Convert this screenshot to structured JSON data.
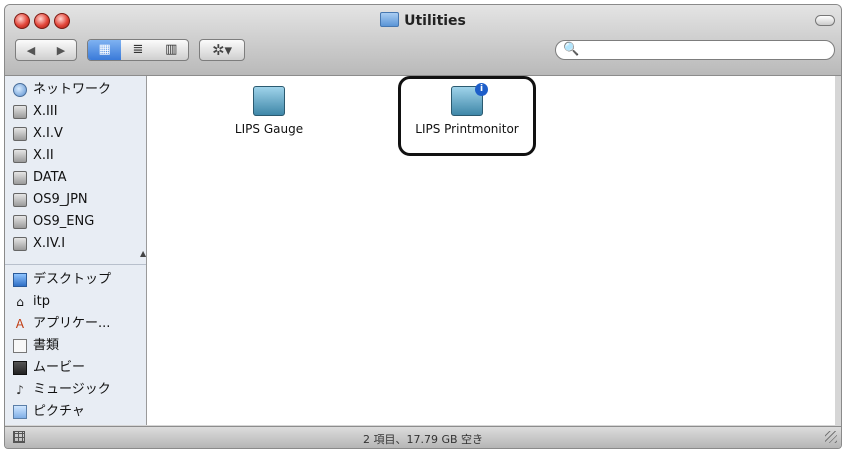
{
  "window": {
    "title": "Utilities"
  },
  "toolbar": {
    "back_glyph": "◀",
    "forward_glyph": "▶",
    "view_icon": "▦",
    "view_list": "≣",
    "view_column": "▥",
    "action_glyph": "✲▾",
    "search_placeholder": "",
    "search_glyph": "🔍"
  },
  "sidebar": {
    "items": [
      {
        "label": "ネットワーク",
        "icon": "globe-icon"
      },
      {
        "label": "X.III",
        "icon": "disk-icon"
      },
      {
        "label": "X.I.V",
        "icon": "disk-icon"
      },
      {
        "label": "X.II",
        "icon": "disk-icon"
      },
      {
        "label": "DATA",
        "icon": "disk-icon"
      },
      {
        "label": "OS9_JPN",
        "icon": "disk-icon"
      },
      {
        "label": "OS9_ENG",
        "icon": "disk-icon"
      },
      {
        "label": "X.IV.I",
        "icon": "disk-icon"
      },
      {
        "label": "デスクトップ",
        "icon": "desktop-icon"
      },
      {
        "label": "itp",
        "icon": "home-icon"
      },
      {
        "label": "アプリケー...",
        "icon": "applications-icon"
      },
      {
        "label": "書類",
        "icon": "documents-icon"
      },
      {
        "label": "ムービー",
        "icon": "movies-icon"
      },
      {
        "label": "ミュージック",
        "icon": "music-icon"
      },
      {
        "label": "ピクチャ",
        "icon": "pictures-icon"
      }
    ]
  },
  "files": [
    {
      "label": "LIPS Gauge",
      "icon": "printer-gauge-icon"
    },
    {
      "label": "LIPS Printmonitor",
      "icon": "printer-monitor-icon",
      "badge": "i"
    }
  ],
  "status": {
    "text": "2 項目、17.79 GB 空き"
  }
}
